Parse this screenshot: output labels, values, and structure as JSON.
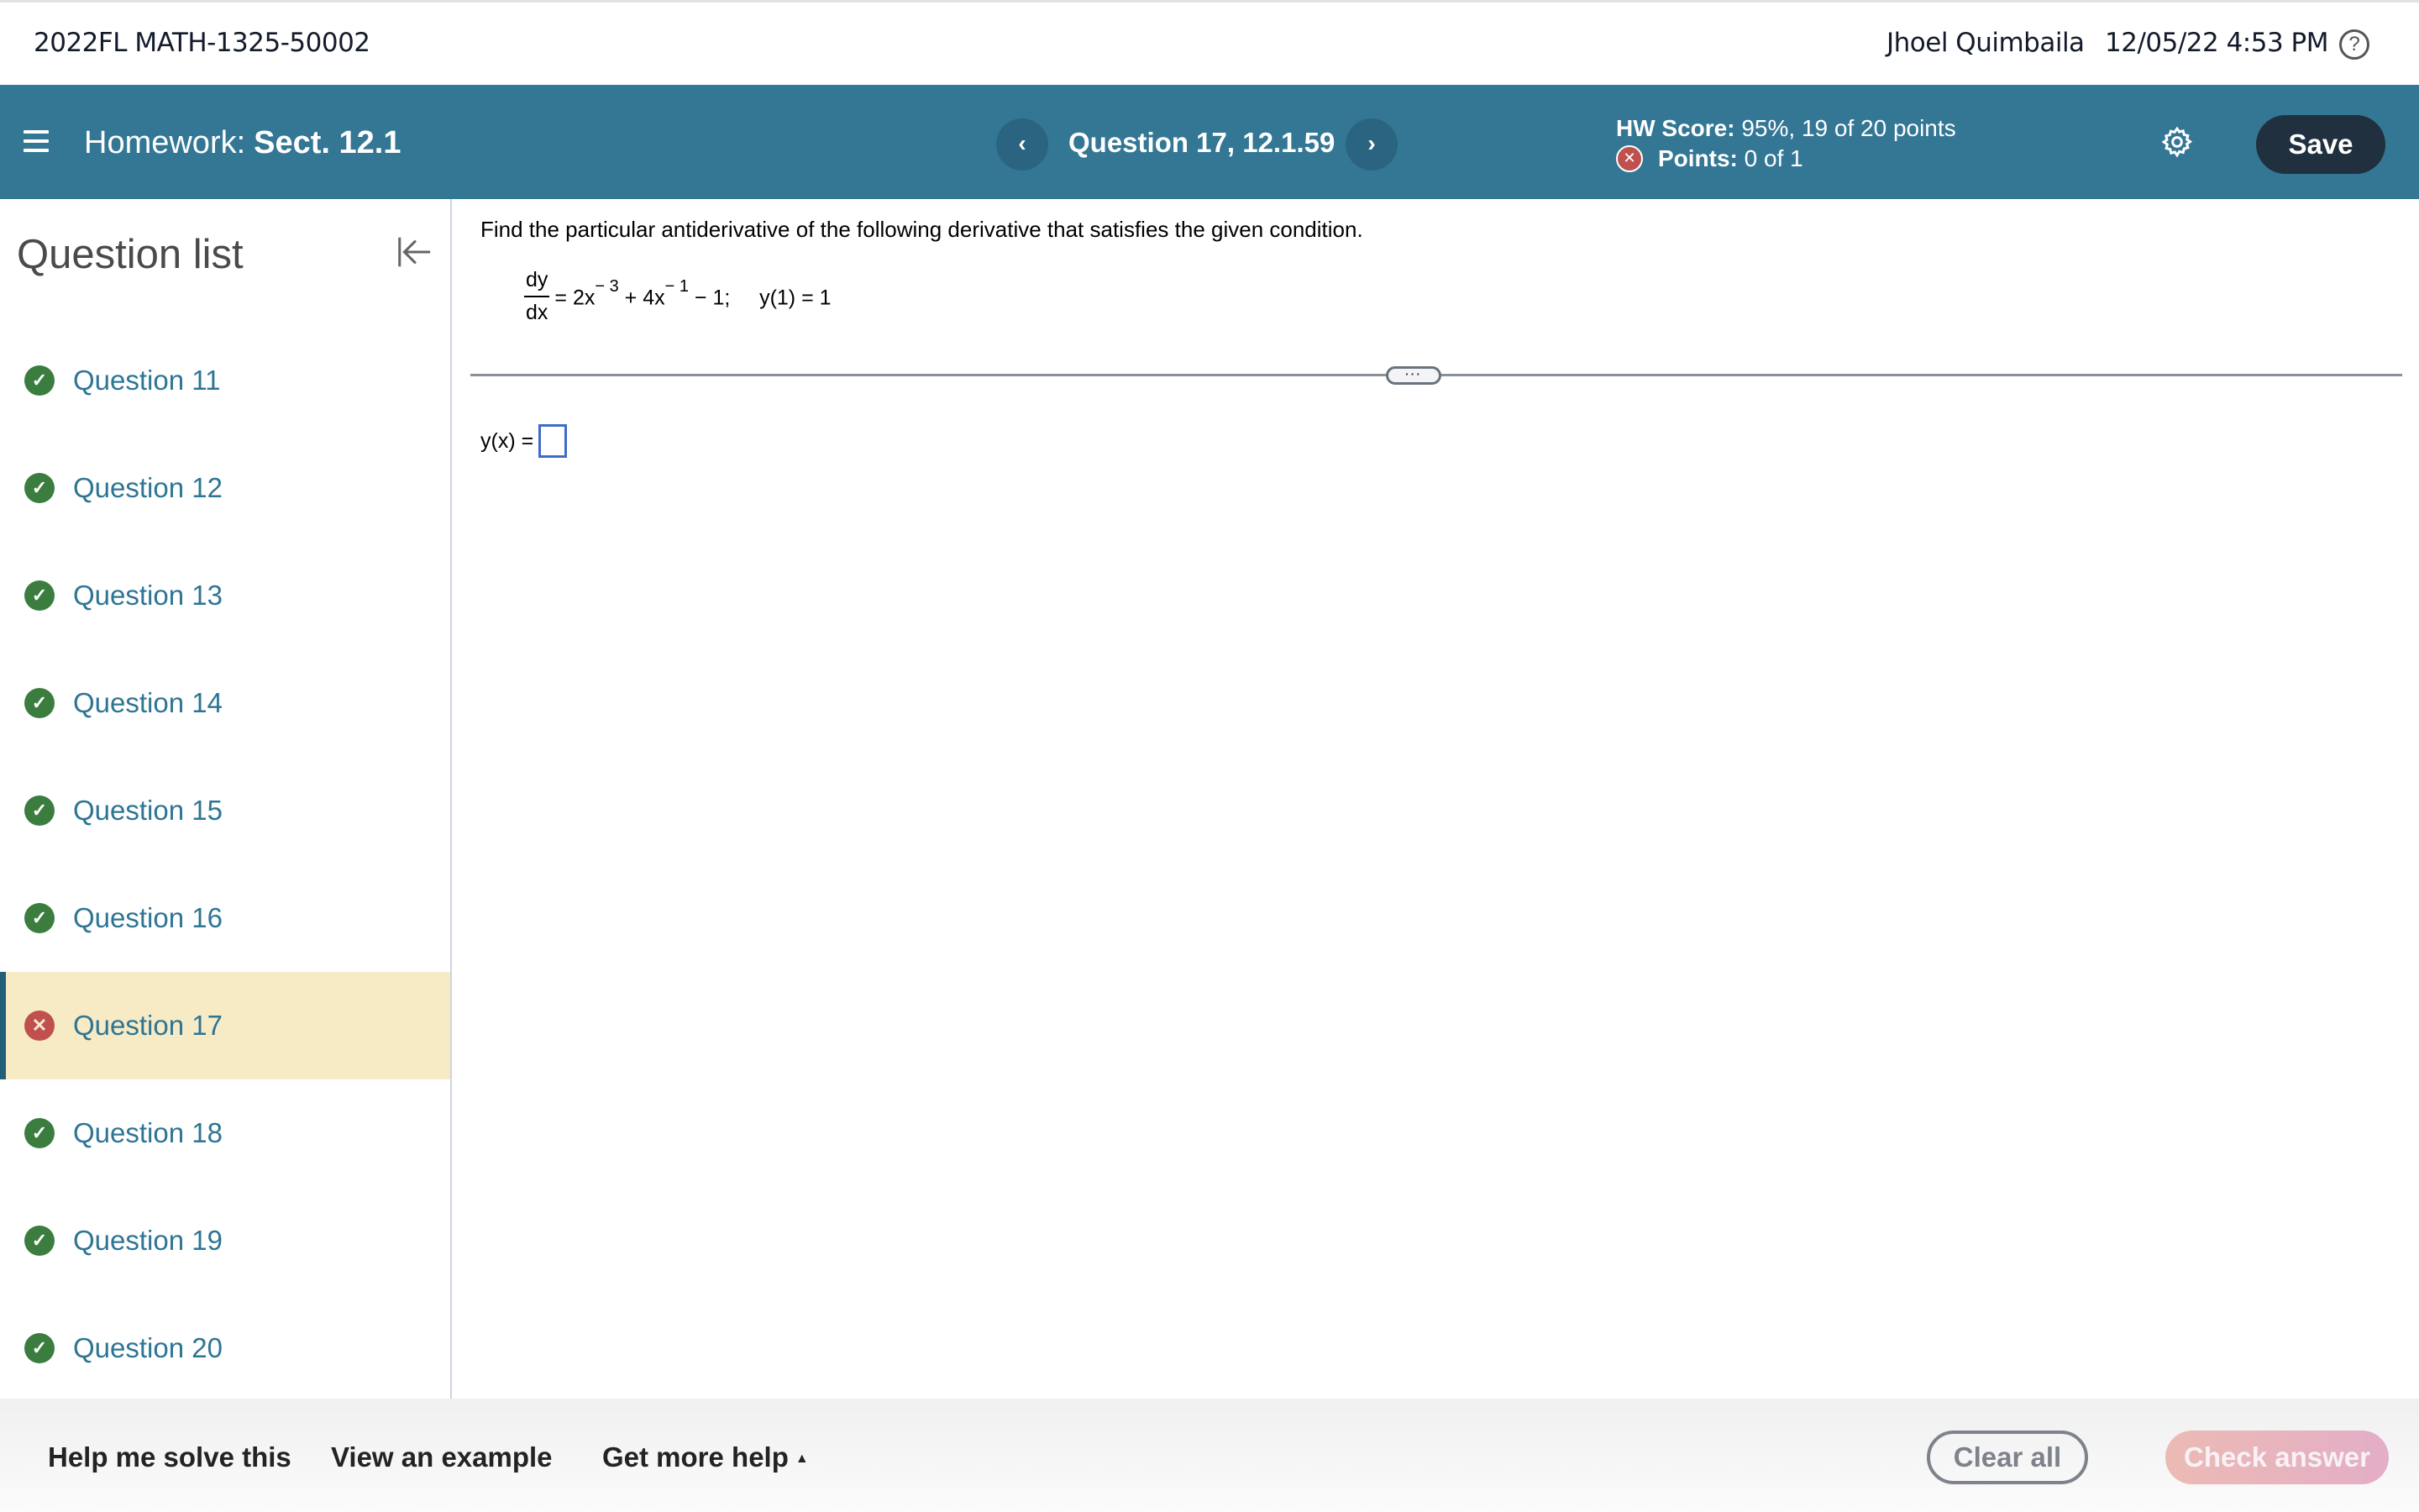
{
  "topbar": {
    "course_title": "2022FL MATH-1325-50002",
    "user_name": "Jhoel Quimbaila",
    "datetime": "12/05/22 4:53 PM",
    "help_glyph": "?"
  },
  "navbar": {
    "homework_label": "Homework:",
    "section": "Sect. 12.1",
    "prev_glyph": "‹",
    "next_glyph": "›",
    "question_title": "Question 17, 12.1.59",
    "hw_score_label": "HW Score:",
    "hw_score_value": "95%, 19 of 20 points",
    "points_label": "Points:",
    "points_value": "0 of 1",
    "points_status_glyph": "✕",
    "save_label": "Save"
  },
  "sidebar": {
    "title": "Question list",
    "items": [
      {
        "label": "Question 11",
        "status": "correct",
        "glyph": "✓"
      },
      {
        "label": "Question 12",
        "status": "correct",
        "glyph": "✓"
      },
      {
        "label": "Question 13",
        "status": "correct",
        "glyph": "✓"
      },
      {
        "label": "Question 14",
        "status": "correct",
        "glyph": "✓"
      },
      {
        "label": "Question 15",
        "status": "correct",
        "glyph": "✓"
      },
      {
        "label": "Question 16",
        "status": "correct",
        "glyph": "✓"
      },
      {
        "label": "Question 17",
        "status": "incorrect",
        "glyph": "✕",
        "active": true
      },
      {
        "label": "Question 18",
        "status": "correct",
        "glyph": "✓"
      },
      {
        "label": "Question 19",
        "status": "correct",
        "glyph": "✓"
      },
      {
        "label": "Question 20",
        "status": "correct",
        "glyph": "✓"
      }
    ]
  },
  "question": {
    "instructions": "Find the particular antiderivative of the following derivative that satisfies the given condition.",
    "eq_num": "dy",
    "eq_den": "dx",
    "eq_part1": " = 2x",
    "eq_exp1": "− 3",
    "eq_part2": " + 4x",
    "eq_exp2": "− 1",
    "eq_part3": " − 1;",
    "condition": "y(1) = 1",
    "divider_handle": "···",
    "answer_label": "y(x) =",
    "answer_value": ""
  },
  "footer": {
    "help_solve": "Help me solve this",
    "view_example": "View an example",
    "more_help": "Get more help",
    "more_help_caret": "▲",
    "clear_all": "Clear all",
    "check_answer": "Check answer"
  },
  "colors": {
    "navbar": "#337795",
    "save_button": "#20303f",
    "correct": "#3a7d3e",
    "incorrect": "#c0504d",
    "active_row": "#f7ebc5",
    "link": "#2e7594"
  }
}
